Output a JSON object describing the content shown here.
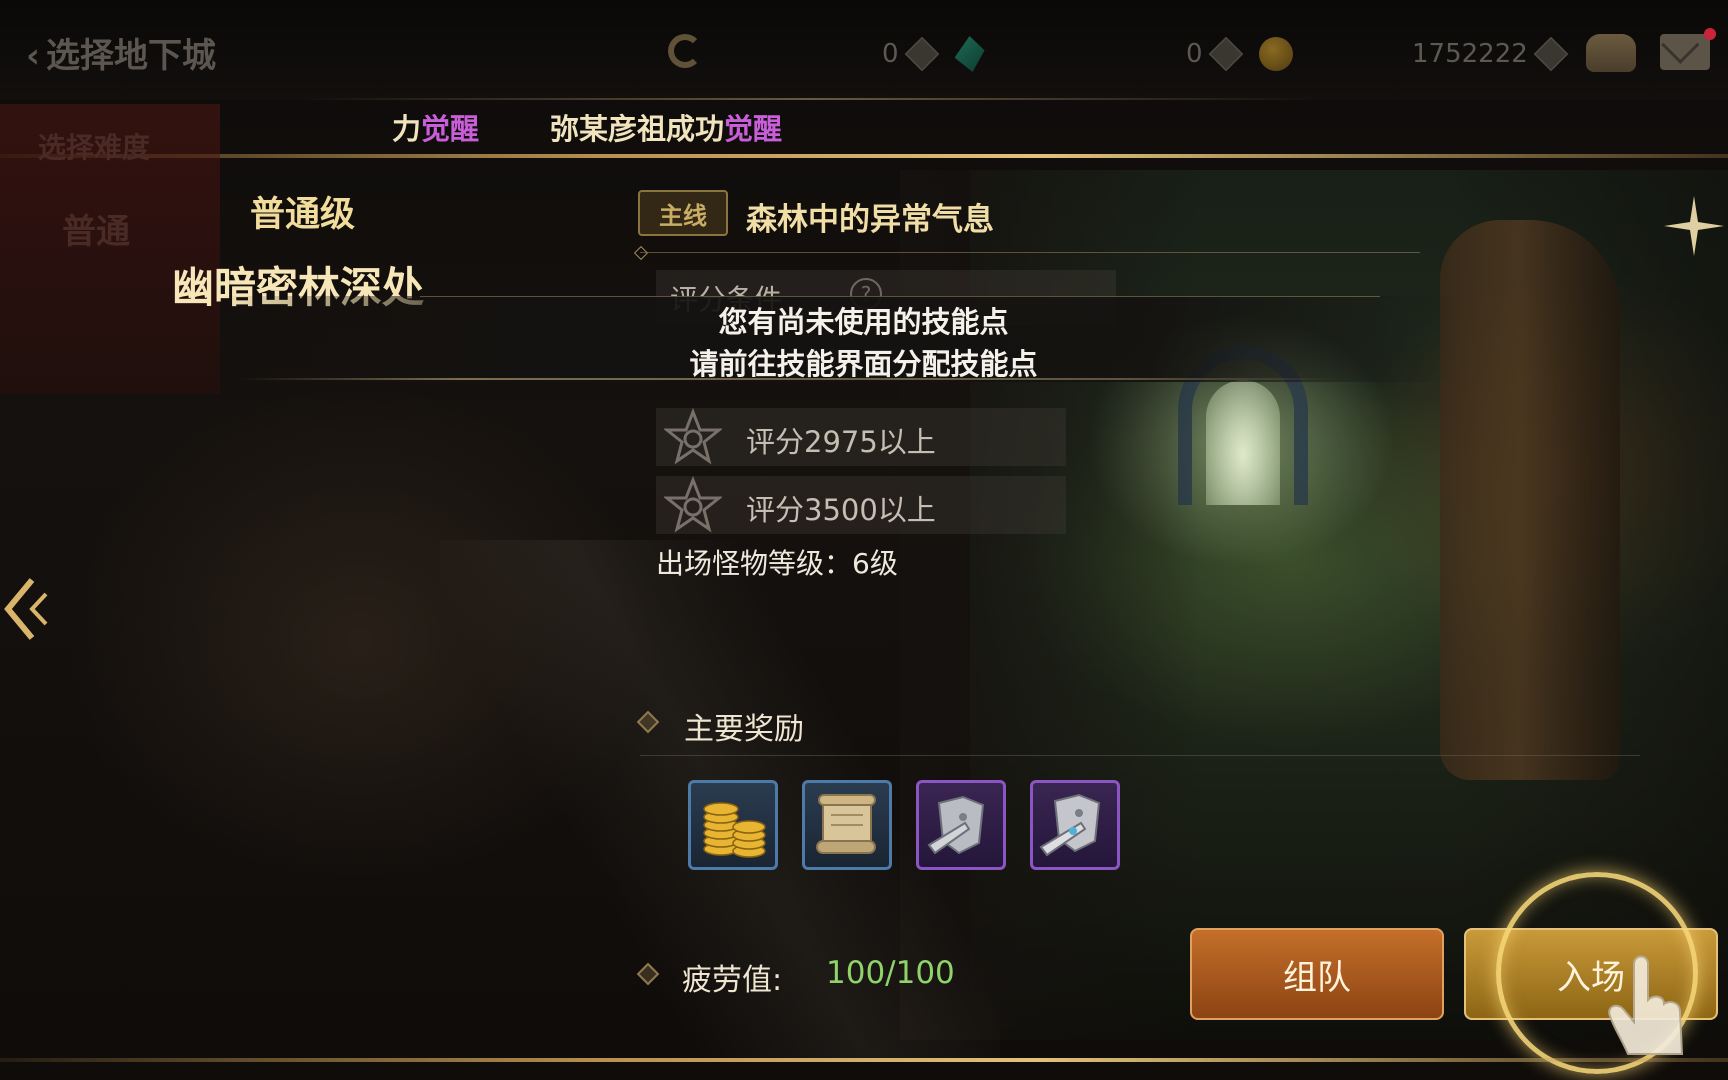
{
  "topbar": {
    "title": "选择地下城",
    "currency": [
      {
        "amount": "0",
        "icon": "gem-icon"
      },
      {
        "amount": "0",
        "icon": "gold-coin-icon"
      },
      {
        "amount": "1752222",
        "icon": "plus-icon"
      }
    ]
  },
  "notice": {
    "part1_prefix": "力",
    "part1_highlight": "觉醒",
    "part2_text": "弥某彦祖成功",
    "part2_highlight": "觉醒"
  },
  "left_ghost": {
    "header": "选择难度",
    "item": "普通"
  },
  "left": {
    "difficulty": "普通级",
    "dungeon_name": "幽暗密林深处"
  },
  "quest": {
    "tag": "主线",
    "title": "森林中的异常气息"
  },
  "rating": {
    "label": "评分条件",
    "help": "?"
  },
  "toast": {
    "line1": "您有尚未使用的技能点",
    "line2": "请前往技能界面分配技能点"
  },
  "conditions": [
    {
      "text": "评分2975以上"
    },
    {
      "text": "评分3500以上"
    }
  ],
  "monster_level": "出场怪物等级：6级",
  "rewards": {
    "title": "主要奖励",
    "items": [
      {
        "icon": "gold-coins-icon",
        "rarity_color": "#4d7aa6"
      },
      {
        "icon": "scroll-icon",
        "rarity_color": "#4d7aa6"
      },
      {
        "icon": "armor-piece-icon",
        "rarity_color": "#8c55c4"
      },
      {
        "icon": "armor-set-icon",
        "rarity_color": "#8c55c4"
      }
    ]
  },
  "fatigue": {
    "label": "疲劳值:",
    "value": "100/100"
  },
  "buttons": {
    "team": "组队",
    "enter": "入场"
  },
  "colors": {
    "accent_gold": "#e2c27a",
    "highlight_purple": "#c85ed8",
    "fatigue_green": "#8fd36a"
  }
}
